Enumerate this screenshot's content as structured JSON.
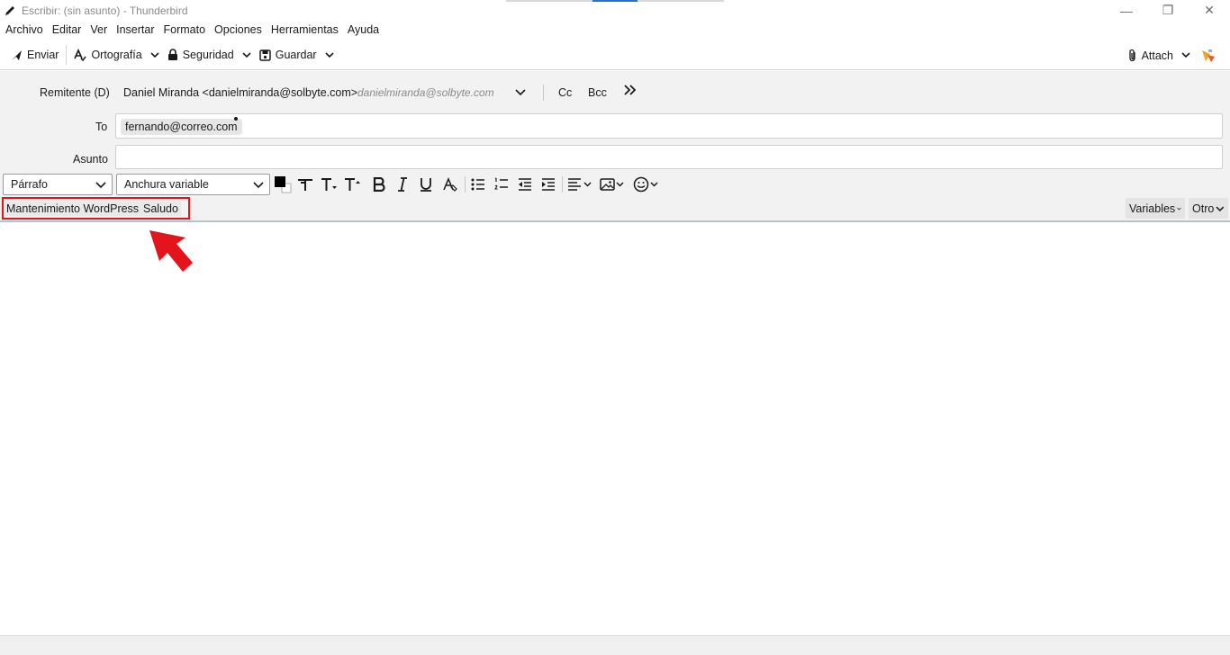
{
  "window": {
    "title": "Escribir: (sin asunto) - Thunderbird",
    "controls": {
      "minimize": "—",
      "restore": "❐",
      "close": "✕"
    }
  },
  "menu": [
    "Archivo",
    "Editar",
    "Ver",
    "Insertar",
    "Formato",
    "Opciones",
    "Herramientas",
    "Ayuda"
  ],
  "toolbar": {
    "send": "Enviar",
    "spelling": "Ortografía",
    "security": "Seguridad",
    "save": "Guardar",
    "attach": "Attach"
  },
  "headers": {
    "from_label": "Remitente (D)",
    "from_value": "Daniel Miranda <danielmiranda@solbyte.com>",
    "from_identity": "danielmiranda@solbyte.com",
    "cc": "Cc",
    "bcc": "Bcc",
    "to_label": "To",
    "to_pill": "fernando@correo.com",
    "subject_label": "Asunto",
    "subject_value": ""
  },
  "format": {
    "paragraph": "Párrafo",
    "font": "Anchura variable"
  },
  "quicktext": {
    "items": [
      "Mantenimiento WordPress",
      "Saludo"
    ],
    "variables": "Variables",
    "other": "Otro"
  },
  "colors": {
    "highlight_box": "#e3141b",
    "arrow": "#e3141b"
  }
}
